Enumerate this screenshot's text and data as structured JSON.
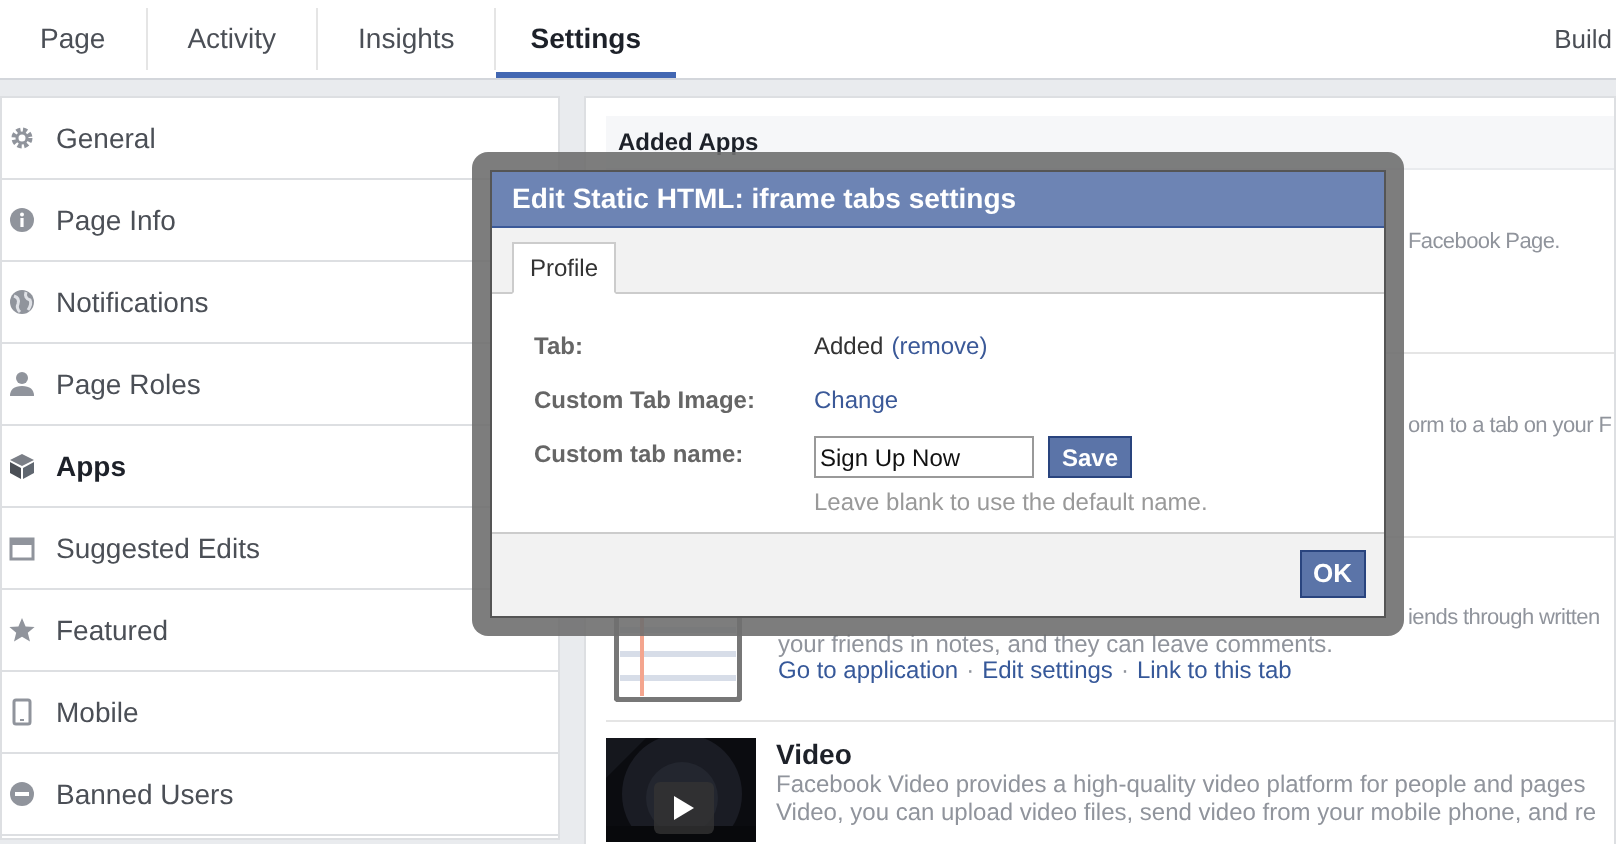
{
  "nav": {
    "tabs": [
      {
        "label": "Page",
        "selected": false
      },
      {
        "label": "Activity",
        "selected": false
      },
      {
        "label": "Insights",
        "selected": false
      },
      {
        "label": "Settings",
        "selected": true
      }
    ],
    "right_link": "Build"
  },
  "sidebar": {
    "items": [
      {
        "label": "General",
        "selected": false
      },
      {
        "label": "Page Info",
        "selected": false
      },
      {
        "label": "Notifications",
        "selected": false
      },
      {
        "label": "Page Roles",
        "selected": false
      },
      {
        "label": "Apps",
        "selected": true
      },
      {
        "label": "Suggested Edits",
        "selected": false
      },
      {
        "label": "Featured",
        "selected": false
      },
      {
        "label": "Mobile",
        "selected": false
      },
      {
        "label": "Banned Users",
        "selected": false
      }
    ]
  },
  "apps": {
    "heading": "Added Apps",
    "rows": [
      {
        "kind": "fragment",
        "text": "Facebook Page."
      },
      {
        "kind": "fragment",
        "text": "orm to a tab on your F"
      },
      {
        "kind": "notes",
        "first_line_tail": "iends through written",
        "description": "your friends in notes, and they can leave comments.",
        "links": [
          "Go to application",
          "Edit settings",
          "Link to this tab"
        ],
        "separator": "·"
      },
      {
        "kind": "video",
        "title": "Video",
        "description": [
          "Facebook Video provides a high-quality video platform for people and pages",
          "Video, you can upload video files, send video from your mobile phone, and re"
        ]
      }
    ]
  },
  "dialog": {
    "title": "Edit Static HTML: iframe tabs settings",
    "tabs": [
      {
        "label": "Profile",
        "selected": true
      }
    ],
    "fields": [
      {
        "kind": "status",
        "label": "Tab:",
        "value": "Added",
        "link": "(remove)"
      },
      {
        "kind": "link",
        "label": "Custom Tab Image:",
        "link": "Change"
      },
      {
        "kind": "input",
        "label": "Custom tab name:",
        "value": "Sign Up Now",
        "button": "Save",
        "hint": "Leave blank to use the default name."
      }
    ],
    "ok_button": "OK"
  }
}
